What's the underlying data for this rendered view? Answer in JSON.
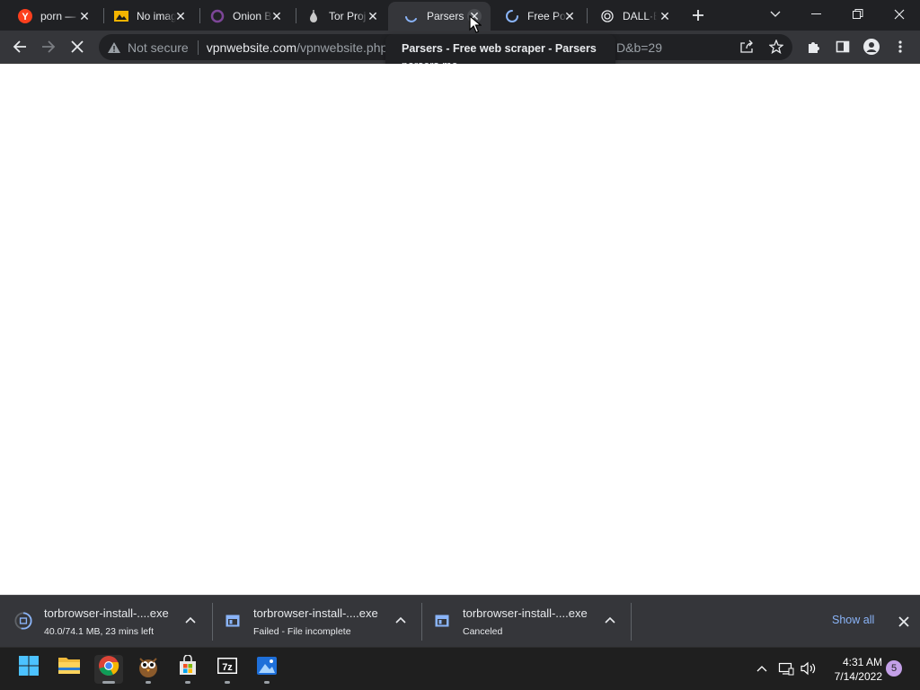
{
  "tabs": [
    {
      "title": "porn — ",
      "icon": "yandex-icon",
      "close": "✕"
    },
    {
      "title": "No image",
      "icon": "no-image-favicon",
      "close": "✕"
    },
    {
      "title": "Onion B",
      "icon": "onion-icon",
      "close": "✕"
    },
    {
      "title": "Tor Proj",
      "icon": "tor-onion-icon",
      "close": "✕"
    },
    {
      "title": "Parsers",
      "icon": "loading-spinner-icon",
      "close": "✕",
      "active": true
    },
    {
      "title": "Free Po",
      "icon": "loading-spinner-icon",
      "close": "✕"
    },
    {
      "title": "DALL·E",
      "icon": "openai-icon",
      "close": "✕"
    }
  ],
  "tooltip": {
    "title": "Parsers - Free web scraper - Parsers",
    "domain": "parsers.me"
  },
  "toolbar": {
    "security_label": "Not secure",
    "url_host": "vpnwebsite.com",
    "url_path": "/vpnwebsite.php",
    "url_tail": "D&b=29"
  },
  "downloads": [
    {
      "filename": "torbrowser-install-....exe",
      "status": "40.0/74.1 MB, 23 mins left",
      "icon": "download-progress-icon",
      "progress": 0.54
    },
    {
      "filename": "torbrowser-install-....exe",
      "status": "Failed - File incomplete",
      "icon": "exe-file-icon"
    },
    {
      "filename": "torbrowser-install-....exe",
      "status": "Canceled",
      "icon": "exe-file-icon"
    }
  ],
  "shelf": {
    "show_all": "Show all"
  },
  "taskbar": {
    "apps": [
      "windows-start-icon",
      "file-explorer-icon",
      "chrome-icon",
      "owl-app-icon",
      "microsoft-store-icon",
      "7zip-icon",
      "photos-icon"
    ],
    "time": "4:31 AM",
    "date": "7/14/2022",
    "notification_count": "5"
  },
  "colors": {
    "tabstrip": "#202124",
    "toolbar": "#35363a",
    "link": "#8ab4f8",
    "taskbar": "#1f1f1f"
  }
}
